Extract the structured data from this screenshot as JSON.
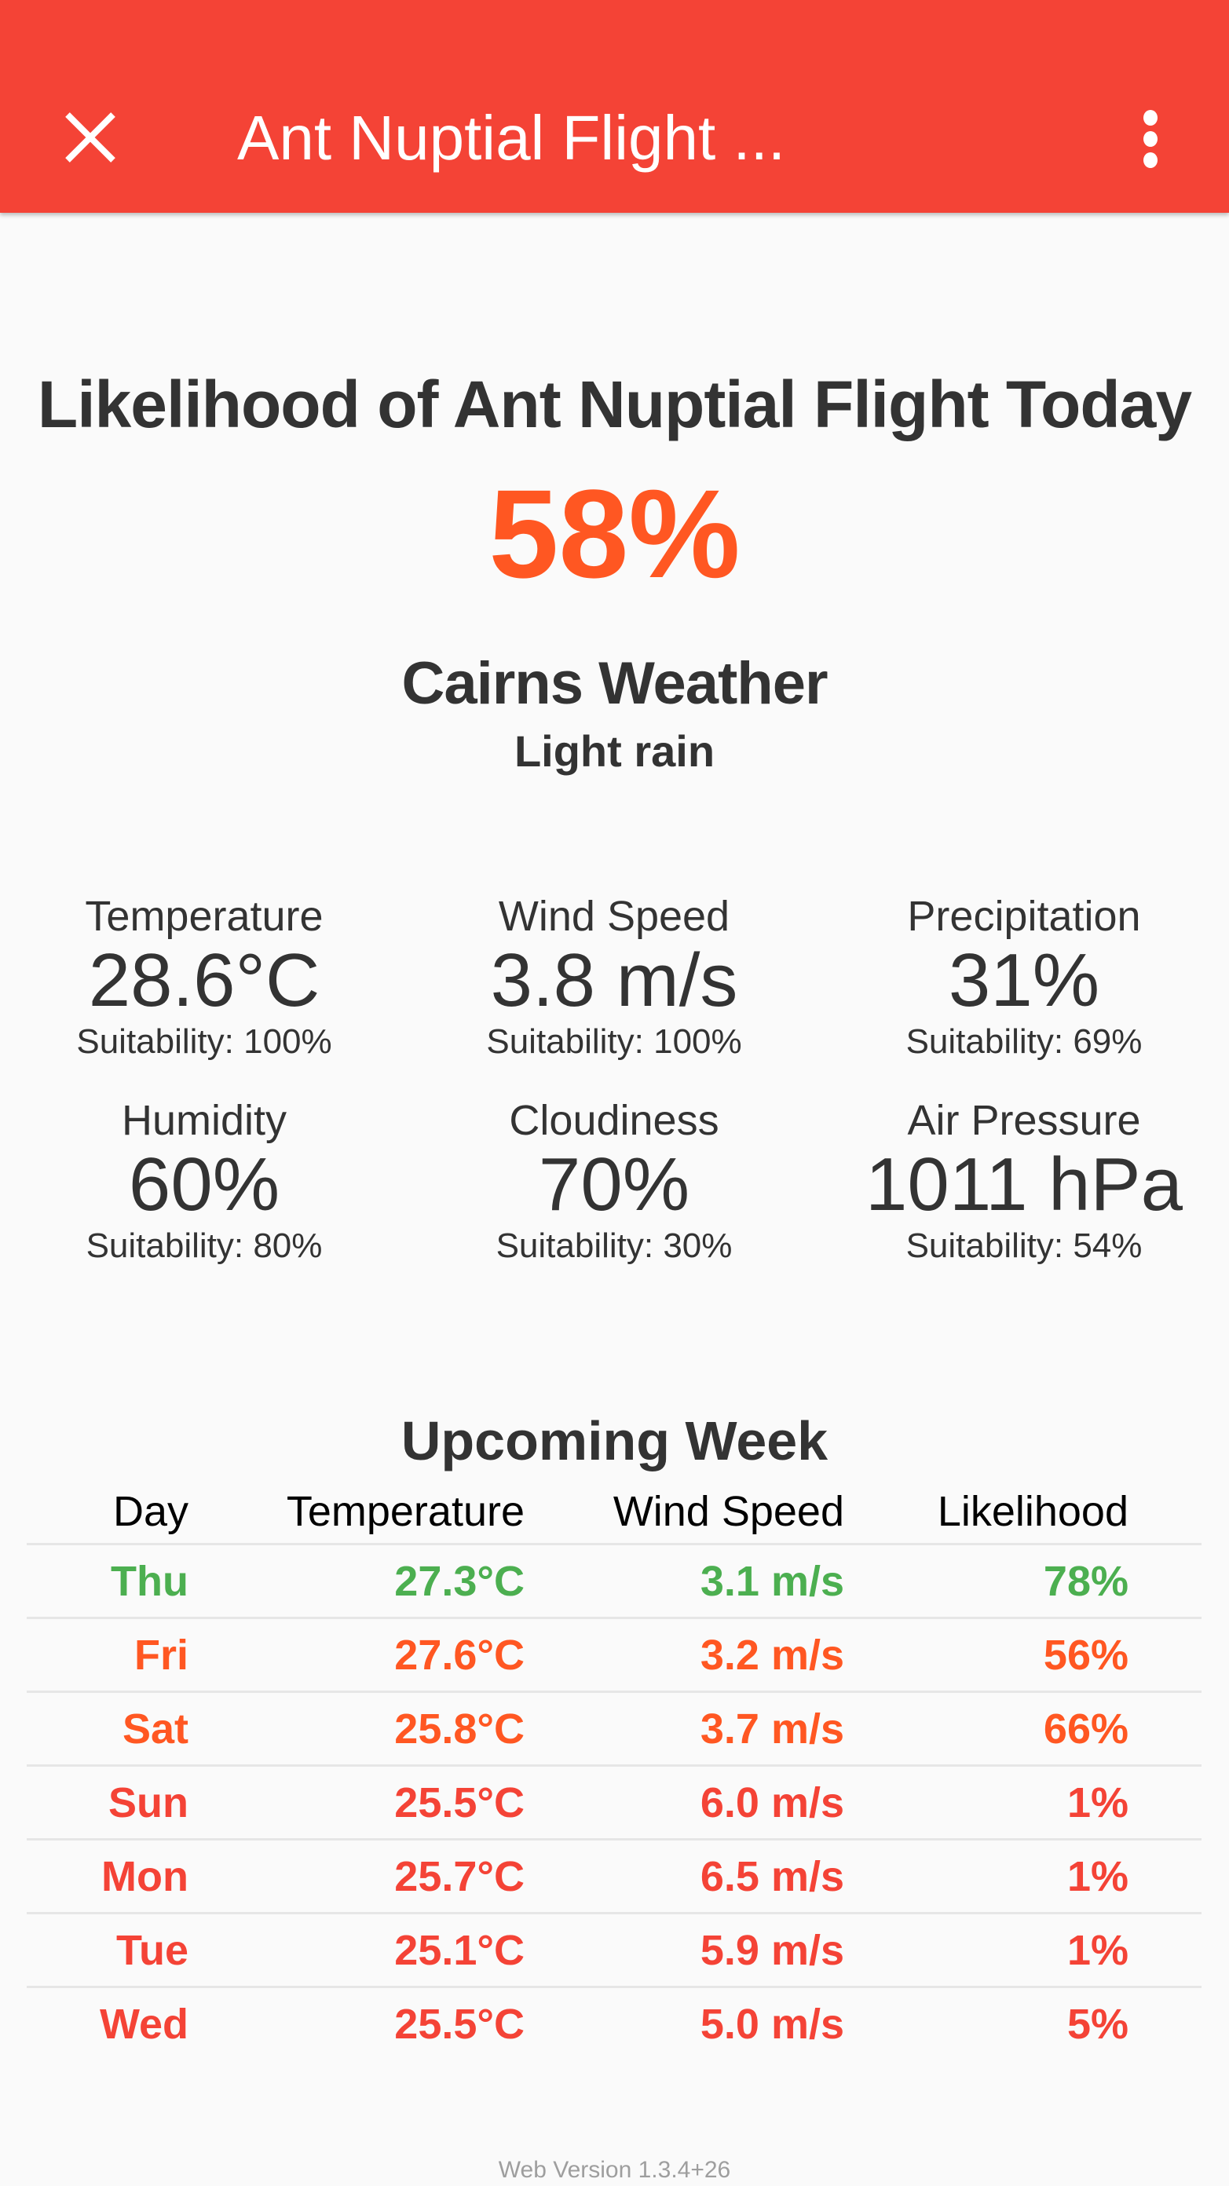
{
  "appbar": {
    "title": "Ant Nuptial Flight ...",
    "close_icon": "close-icon",
    "menu_icon": "more-vert-icon",
    "color": "#f44336"
  },
  "main": {
    "heading": "Likelihood of Ant Nuptial Flight Today",
    "likelihood": "58%",
    "likelihood_color": "#ff5722",
    "weather_title": "Cairns Weather",
    "weather_desc": "Light rain",
    "stats": [
      {
        "label": "Temperature",
        "value": "28.6°C",
        "suitability": "Suitability: 100%"
      },
      {
        "label": "Wind Speed",
        "value": "3.8 m/s",
        "suitability": "Suitability: 100%"
      },
      {
        "label": "Precipitation",
        "value": "31%",
        "suitability": "Suitability: 69%"
      },
      {
        "label": "Humidity",
        "value": "60%",
        "suitability": "Suitability: 80%"
      },
      {
        "label": "Cloudiness",
        "value": "70%",
        "suitability": "Suitability: 30%"
      },
      {
        "label": "Air Pressure",
        "value": "1011 hPa",
        "suitability": "Suitability: 54%"
      }
    ]
  },
  "week": {
    "title": "Upcoming Week",
    "headers": [
      "Day",
      "Temperature",
      "Wind Speed",
      "Likelihood"
    ],
    "rows": [
      {
        "day": "Thu",
        "temp": "27.3°C",
        "wind": "3.1 m/s",
        "likelihood": "78%",
        "color": "#4caf50"
      },
      {
        "day": "Fri",
        "temp": "27.6°C",
        "wind": "3.2 m/s",
        "likelihood": "56%",
        "color": "#ff5722"
      },
      {
        "day": "Sat",
        "temp": "25.8°C",
        "wind": "3.7 m/s",
        "likelihood": "66%",
        "color": "#ff5722"
      },
      {
        "day": "Sun",
        "temp": "25.5°C",
        "wind": "6.0 m/s",
        "likelihood": "1%",
        "color": "#f44336"
      },
      {
        "day": "Mon",
        "temp": "25.7°C",
        "wind": "6.5 m/s",
        "likelihood": "1%",
        "color": "#f44336"
      },
      {
        "day": "Tue",
        "temp": "25.1°C",
        "wind": "5.9 m/s",
        "likelihood": "1%",
        "color": "#f44336"
      },
      {
        "day": "Wed",
        "temp": "25.5°C",
        "wind": "5.0 m/s",
        "likelihood": "5%",
        "color": "#f44336"
      }
    ]
  },
  "footer": {
    "version": "Web Version 1.3.4+26"
  }
}
